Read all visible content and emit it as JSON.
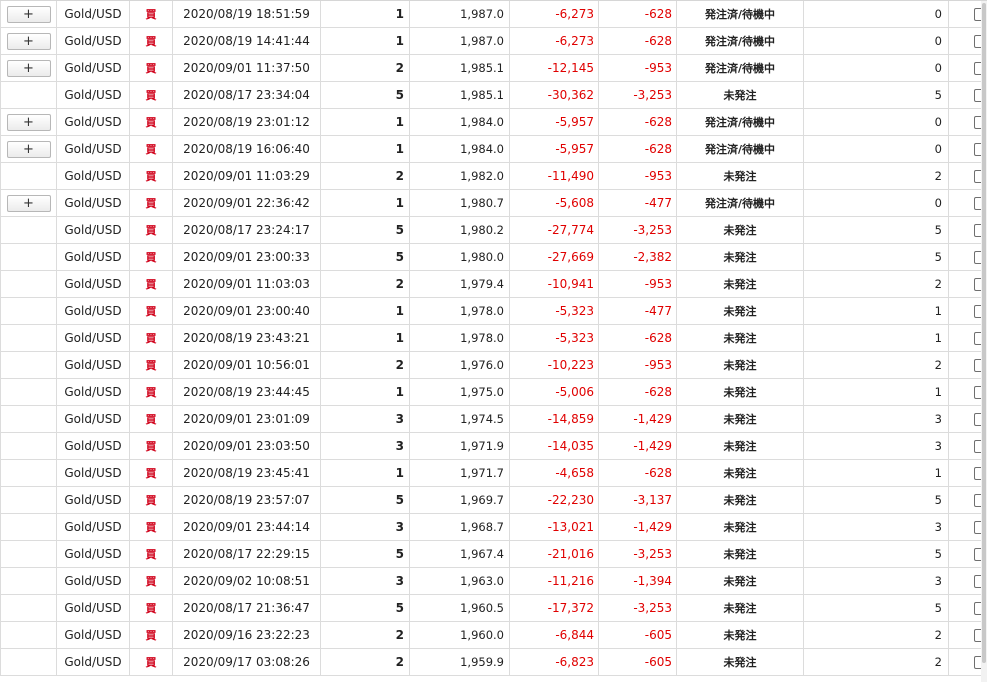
{
  "buttons": {
    "expand_label": "+"
  },
  "rows": [
    {
      "expand": true,
      "symbol": "Gold/USD",
      "side": "買",
      "time": "2020/08/19 18:51:59",
      "qty": "1",
      "price": "1,987.0",
      "pl1": "-6,273",
      "pl2": "-628",
      "status": "発注済/待機中",
      "count": "0"
    },
    {
      "expand": true,
      "symbol": "Gold/USD",
      "side": "買",
      "time": "2020/08/19 14:41:44",
      "qty": "1",
      "price": "1,987.0",
      "pl1": "-6,273",
      "pl2": "-628",
      "status": "発注済/待機中",
      "count": "0"
    },
    {
      "expand": true,
      "symbol": "Gold/USD",
      "side": "買",
      "time": "2020/09/01 11:37:50",
      "qty": "2",
      "price": "1,985.1",
      "pl1": "-12,145",
      "pl2": "-953",
      "status": "発注済/待機中",
      "count": "0"
    },
    {
      "expand": false,
      "symbol": "Gold/USD",
      "side": "買",
      "time": "2020/08/17 23:34:04",
      "qty": "5",
      "price": "1,985.1",
      "pl1": "-30,362",
      "pl2": "-3,253",
      "status": "未発注",
      "count": "5"
    },
    {
      "expand": true,
      "symbol": "Gold/USD",
      "side": "買",
      "time": "2020/08/19 23:01:12",
      "qty": "1",
      "price": "1,984.0",
      "pl1": "-5,957",
      "pl2": "-628",
      "status": "発注済/待機中",
      "count": "0"
    },
    {
      "expand": true,
      "symbol": "Gold/USD",
      "side": "買",
      "time": "2020/08/19 16:06:40",
      "qty": "1",
      "price": "1,984.0",
      "pl1": "-5,957",
      "pl2": "-628",
      "status": "発注済/待機中",
      "count": "0"
    },
    {
      "expand": false,
      "symbol": "Gold/USD",
      "side": "買",
      "time": "2020/09/01 11:03:29",
      "qty": "2",
      "price": "1,982.0",
      "pl1": "-11,490",
      "pl2": "-953",
      "status": "未発注",
      "count": "2"
    },
    {
      "expand": true,
      "symbol": "Gold/USD",
      "side": "買",
      "time": "2020/09/01 22:36:42",
      "qty": "1",
      "price": "1,980.7",
      "pl1": "-5,608",
      "pl2": "-477",
      "status": "発注済/待機中",
      "count": "0"
    },
    {
      "expand": false,
      "symbol": "Gold/USD",
      "side": "買",
      "time": "2020/08/17 23:24:17",
      "qty": "5",
      "price": "1,980.2",
      "pl1": "-27,774",
      "pl2": "-3,253",
      "status": "未発注",
      "count": "5"
    },
    {
      "expand": false,
      "symbol": "Gold/USD",
      "side": "買",
      "time": "2020/09/01 23:00:33",
      "qty": "5",
      "price": "1,980.0",
      "pl1": "-27,669",
      "pl2": "-2,382",
      "status": "未発注",
      "count": "5"
    },
    {
      "expand": false,
      "symbol": "Gold/USD",
      "side": "買",
      "time": "2020/09/01 11:03:03",
      "qty": "2",
      "price": "1,979.4",
      "pl1": "-10,941",
      "pl2": "-953",
      "status": "未発注",
      "count": "2"
    },
    {
      "expand": false,
      "symbol": "Gold/USD",
      "side": "買",
      "time": "2020/09/01 23:00:40",
      "qty": "1",
      "price": "1,978.0",
      "pl1": "-5,323",
      "pl2": "-477",
      "status": "未発注",
      "count": "1"
    },
    {
      "expand": false,
      "symbol": "Gold/USD",
      "side": "買",
      "time": "2020/08/19 23:43:21",
      "qty": "1",
      "price": "1,978.0",
      "pl1": "-5,323",
      "pl2": "-628",
      "status": "未発注",
      "count": "1"
    },
    {
      "expand": false,
      "symbol": "Gold/USD",
      "side": "買",
      "time": "2020/09/01 10:56:01",
      "qty": "2",
      "price": "1,976.0",
      "pl1": "-10,223",
      "pl2": "-953",
      "status": "未発注",
      "count": "2"
    },
    {
      "expand": false,
      "symbol": "Gold/USD",
      "side": "買",
      "time": "2020/08/19 23:44:45",
      "qty": "1",
      "price": "1,975.0",
      "pl1": "-5,006",
      "pl2": "-628",
      "status": "未発注",
      "count": "1"
    },
    {
      "expand": false,
      "symbol": "Gold/USD",
      "side": "買",
      "time": "2020/09/01 23:01:09",
      "qty": "3",
      "price": "1,974.5",
      "pl1": "-14,859",
      "pl2": "-1,429",
      "status": "未発注",
      "count": "3"
    },
    {
      "expand": false,
      "symbol": "Gold/USD",
      "side": "買",
      "time": "2020/09/01 23:03:50",
      "qty": "3",
      "price": "1,971.9",
      "pl1": "-14,035",
      "pl2": "-1,429",
      "status": "未発注",
      "count": "3"
    },
    {
      "expand": false,
      "symbol": "Gold/USD",
      "side": "買",
      "time": "2020/08/19 23:45:41",
      "qty": "1",
      "price": "1,971.7",
      "pl1": "-4,658",
      "pl2": "-628",
      "status": "未発注",
      "count": "1"
    },
    {
      "expand": false,
      "symbol": "Gold/USD",
      "side": "買",
      "time": "2020/08/19 23:57:07",
      "qty": "5",
      "price": "1,969.7",
      "pl1": "-22,230",
      "pl2": "-3,137",
      "status": "未発注",
      "count": "5"
    },
    {
      "expand": false,
      "symbol": "Gold/USD",
      "side": "買",
      "time": "2020/09/01 23:44:14",
      "qty": "3",
      "price": "1,968.7",
      "pl1": "-13,021",
      "pl2": "-1,429",
      "status": "未発注",
      "count": "3"
    },
    {
      "expand": false,
      "symbol": "Gold/USD",
      "side": "買",
      "time": "2020/08/17 22:29:15",
      "qty": "5",
      "price": "1,967.4",
      "pl1": "-21,016",
      "pl2": "-3,253",
      "status": "未発注",
      "count": "5"
    },
    {
      "expand": false,
      "symbol": "Gold/USD",
      "side": "買",
      "time": "2020/09/02 10:08:51",
      "qty": "3",
      "price": "1,963.0",
      "pl1": "-11,216",
      "pl2": "-1,394",
      "status": "未発注",
      "count": "3"
    },
    {
      "expand": false,
      "symbol": "Gold/USD",
      "side": "買",
      "time": "2020/08/17 21:36:47",
      "qty": "5",
      "price": "1,960.5",
      "pl1": "-17,372",
      "pl2": "-3,253",
      "status": "未発注",
      "count": "5"
    },
    {
      "expand": false,
      "symbol": "Gold/USD",
      "side": "買",
      "time": "2020/09/16 23:22:23",
      "qty": "2",
      "price": "1,960.0",
      "pl1": "-6,844",
      "pl2": "-605",
      "status": "未発注",
      "count": "2"
    },
    {
      "expand": false,
      "symbol": "Gold/USD",
      "side": "買",
      "time": "2020/09/17 03:08:26",
      "qty": "2",
      "price": "1,959.9",
      "pl1": "-6,823",
      "pl2": "-605",
      "status": "未発注",
      "count": "2"
    }
  ]
}
